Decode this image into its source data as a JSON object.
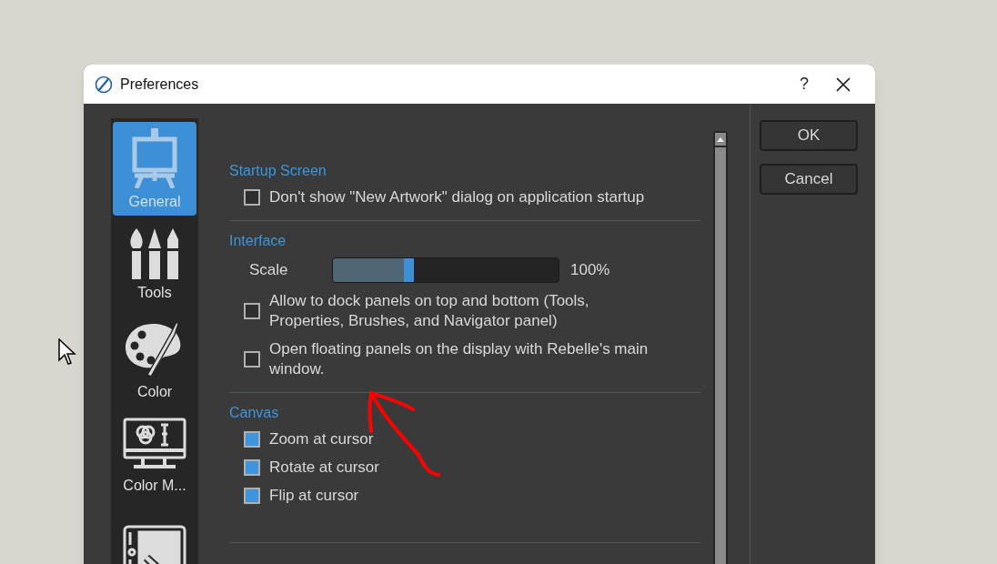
{
  "window": {
    "title": "Preferences",
    "help": "?"
  },
  "sidebar": {
    "items": [
      {
        "label": "General",
        "selected": true
      },
      {
        "label": "Tools",
        "selected": false
      },
      {
        "label": "Color",
        "selected": false
      },
      {
        "label": "Color M...",
        "selected": false
      },
      {
        "selected": false
      }
    ]
  },
  "sections": [
    {
      "title": "Startup Screen",
      "items": [
        {
          "kind": "checkbox",
          "label": "Don't show \"New Artwork\" dialog on application startup",
          "checked": false
        }
      ]
    },
    {
      "title": "Interface",
      "items": [
        {
          "kind": "slider",
          "label": "Scale",
          "level": 0.36,
          "reading": "100%"
        },
        {
          "kind": "checkbox",
          "label": "Allow to dock panels on top and bottom (Tools, Properties, Brushes, and Navigator panel)",
          "checked": false
        },
        {
          "kind": "checkbox",
          "label": "Open floating panels on the display with Rebelle's main window.",
          "checked": false
        }
      ]
    },
    {
      "title": "Canvas",
      "items": [
        {
          "kind": "checkbox",
          "label": "Zoom at cursor",
          "checked": true
        },
        {
          "kind": "checkbox",
          "label": "Rotate at cursor",
          "checked": true
        },
        {
          "kind": "checkbox",
          "label": "Flip at cursor",
          "checked": true
        }
      ]
    }
  ],
  "buttons": [
    "OK",
    "Cancel"
  ]
}
